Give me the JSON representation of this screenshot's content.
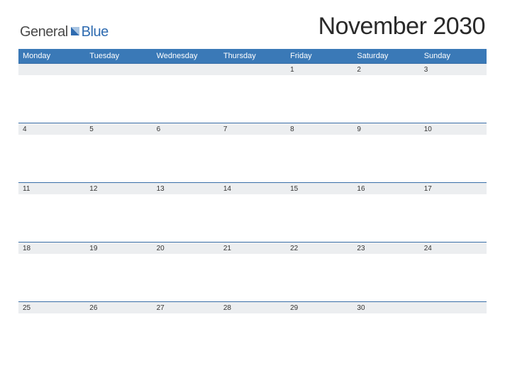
{
  "logo": {
    "text1": "General",
    "text2": "Blue"
  },
  "title": "November 2030",
  "colors": {
    "header_bar": "#3a79b7",
    "rule": "#3a6fa8",
    "band": "#eceef0"
  },
  "day_headers": [
    "Monday",
    "Tuesday",
    "Wednesday",
    "Thursday",
    "Friday",
    "Saturday",
    "Sunday"
  ],
  "weeks": [
    [
      "",
      "",
      "",
      "",
      "1",
      "2",
      "3"
    ],
    [
      "4",
      "5",
      "6",
      "7",
      "8",
      "9",
      "10"
    ],
    [
      "11",
      "12",
      "13",
      "14",
      "15",
      "16",
      "17"
    ],
    [
      "18",
      "19",
      "20",
      "21",
      "22",
      "23",
      "24"
    ],
    [
      "25",
      "26",
      "27",
      "28",
      "29",
      "30",
      ""
    ]
  ]
}
